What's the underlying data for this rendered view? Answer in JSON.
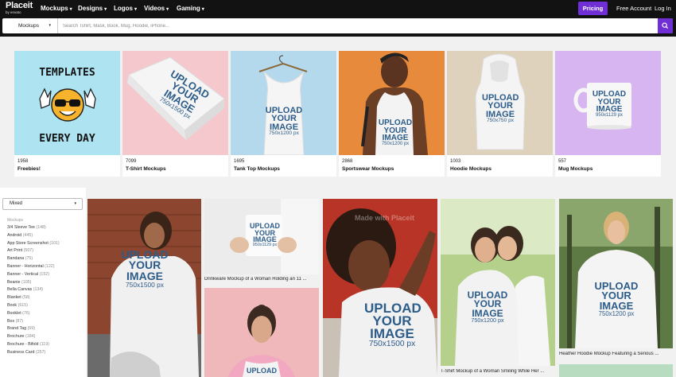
{
  "nav": {
    "logo_name": "Placeit",
    "logo_sub": "by envato",
    "items": [
      {
        "label": "Mockups"
      },
      {
        "label": "Designs"
      },
      {
        "label": "Logos"
      },
      {
        "label": "Videos"
      },
      {
        "label": "Gaming"
      }
    ],
    "pricing": "Pricing",
    "free_account": "Free Account",
    "login": "Log In"
  },
  "search": {
    "category": "Mockups",
    "placeholder": "Search Tshirt, Mask, Book, Mug, Hoodie, iPhone...",
    "icon": "search-icon"
  },
  "categories": [
    {
      "count": "1958",
      "label": "Freebies!",
      "art": {
        "line1": "TEMPLATES",
        "line2": "EVERY DAY"
      }
    },
    {
      "count": "7099",
      "label": "T-Shirt Mockups",
      "art": {
        "l1": "UPLOAD",
        "l2": "YOUR",
        "l3": "IMAGE",
        "dim": "750x1500 px"
      }
    },
    {
      "count": "1695",
      "label": "Tank Top Mockups",
      "art": {
        "l1": "UPLOAD",
        "l2": "YOUR",
        "l3": "IMAGE",
        "dim": "750x1200 px"
      }
    },
    {
      "count": "2868",
      "label": "Sportswear Mockups",
      "art": {
        "l1": "UPLOAD",
        "l2": "YOUR",
        "l3": "IMAGE",
        "dim": "750x1200 px"
      }
    },
    {
      "count": "1003",
      "label": "Hoodie Mockups",
      "art": {
        "l1": "UPLOAD",
        "l2": "YOUR",
        "l3": "IMAGE",
        "dim": "750x750 px"
      }
    },
    {
      "count": "557",
      "label": "Mug Mockups",
      "art": {
        "l1": "UPLOAD",
        "l2": "YOUR",
        "l3": "IMAGE",
        "dim": "950x1129 px"
      }
    }
  ],
  "sidebar": {
    "sort": "Mixed",
    "heading": "Mockups",
    "items": [
      {
        "name": "3/4 Sleeve Tee",
        "count": "(148)"
      },
      {
        "name": "Android",
        "count": "(445)"
      },
      {
        "name": "App Store Screenshot",
        "count": "(101)"
      },
      {
        "name": "Art Print",
        "count": "(507)"
      },
      {
        "name": "Bandana",
        "count": "(75)"
      },
      {
        "name": "Banner - Horizontal",
        "count": "(122)"
      },
      {
        "name": "Banner - Vertical",
        "count": "(152)"
      },
      {
        "name": "Beanie",
        "count": "(105)"
      },
      {
        "name": "Bella Canvas",
        "count": "(134)"
      },
      {
        "name": "Blanket",
        "count": "(58)"
      },
      {
        "name": "Book",
        "count": "(615)"
      },
      {
        "name": "Booklet",
        "count": "(76)"
      },
      {
        "name": "Box",
        "count": "(87)"
      },
      {
        "name": "Brand Tag",
        "count": "(69)"
      },
      {
        "name": "Brochure",
        "count": "(184)"
      },
      {
        "name": "Brochure - Bifold",
        "count": "(119)"
      },
      {
        "name": "Business Card",
        "count": "(257)"
      }
    ]
  },
  "results": {
    "t1": {
      "l1": "UPLOAD",
      "l2": "YOUR",
      "l3": "IMAGE",
      "dim": "750x1500 px"
    },
    "t2": {
      "l1": "UPLOAD",
      "l2": "YOUR",
      "l3": "IMAGE",
      "dim": "950x1129 px",
      "caption": "Drinkware Mockup of a Woman Holding an 11 ..."
    },
    "t3": {
      "l1": "UPLOAD",
      "l2": "YOUR",
      "l3": "IMAGE",
      "dim": "750x1500 px",
      "watermark": "Made with Placeit"
    },
    "t4": {
      "l1": "UPLOAD",
      "l2": "YOUR",
      "l3": "IMAGE",
      "dim": "750x1200 px",
      "caption": "T-Shirt Mockup of a Woman Smiling While Her ..."
    },
    "t5": {
      "l1": "UPLOAD",
      "l2": "YOUR",
      "l3": "IMAGE",
      "dim": "750x1200 px",
      "caption": "Heather Hoodie Mockup Featuring a Serious ..."
    },
    "t6": {
      "l1": "UPLOAD"
    }
  },
  "colors": {
    "nav_bg": "#121212",
    "accent": "#6f2fd4",
    "upload_text": "#2c5c8a"
  }
}
